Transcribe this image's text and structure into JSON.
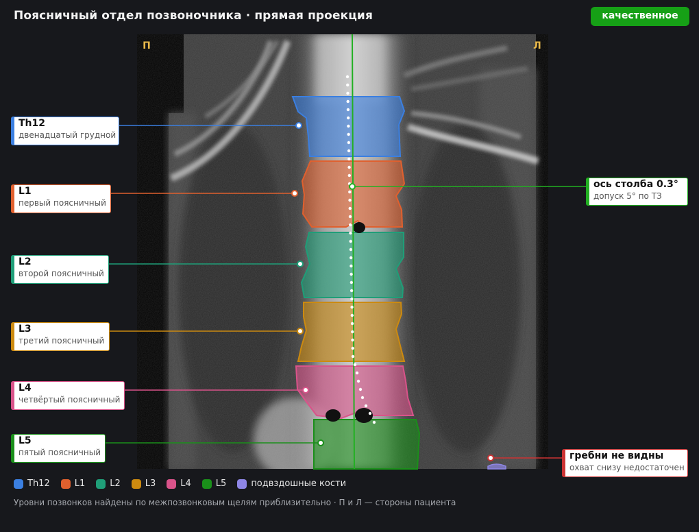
{
  "header": {
    "title": "Поясничный отдел позвоночника · прямая проекция",
    "badge": "качественное"
  },
  "image": {
    "side_right_marker": "П",
    "side_left_marker": "Л"
  },
  "colors": {
    "Th12": "#3b7fe0",
    "L1": "#e0602e",
    "L2": "#1f9e78",
    "L3": "#cc8a10",
    "L4": "#d9538a",
    "L5": "#1a8f1a",
    "iliac": "#8e86e6",
    "axis": "#22b022",
    "warning": "#cc3333"
  },
  "vertebrae": [
    {
      "id": "Th12",
      "name": "Th12",
      "desc": "двенадцатый грудной"
    },
    {
      "id": "L1",
      "name": "L1",
      "desc": "первый поясничный"
    },
    {
      "id": "L2",
      "name": "L2",
      "desc": "второй поясничный"
    },
    {
      "id": "L3",
      "name": "L3",
      "desc": "третий поясничный"
    },
    {
      "id": "L4",
      "name": "L4",
      "desc": "четвёртый поясничный"
    },
    {
      "id": "L5",
      "name": "L5",
      "desc": "пятый поясничный"
    }
  ],
  "axis_callout": {
    "title": "ось столба 0.3°",
    "sub": "допуск 5° по ТЗ",
    "angle_deg": 0.3,
    "tolerance_deg": 5
  },
  "warning_callout": {
    "title": "гребни не видны",
    "sub": "охват снизу недостаточен"
  },
  "legend": [
    {
      "key": "Th12",
      "label": "Th12"
    },
    {
      "key": "L1",
      "label": "L1"
    },
    {
      "key": "L2",
      "label": "L2"
    },
    {
      "key": "L3",
      "label": "L3"
    },
    {
      "key": "L4",
      "label": "L4"
    },
    {
      "key": "L5",
      "label": "L5"
    },
    {
      "key": "iliac",
      "label": "подвздошные кости"
    }
  ],
  "footnote": "Уровни позвонков найдены по межпозвонковым щелям приблизительно · П и Л — стороны пациента"
}
